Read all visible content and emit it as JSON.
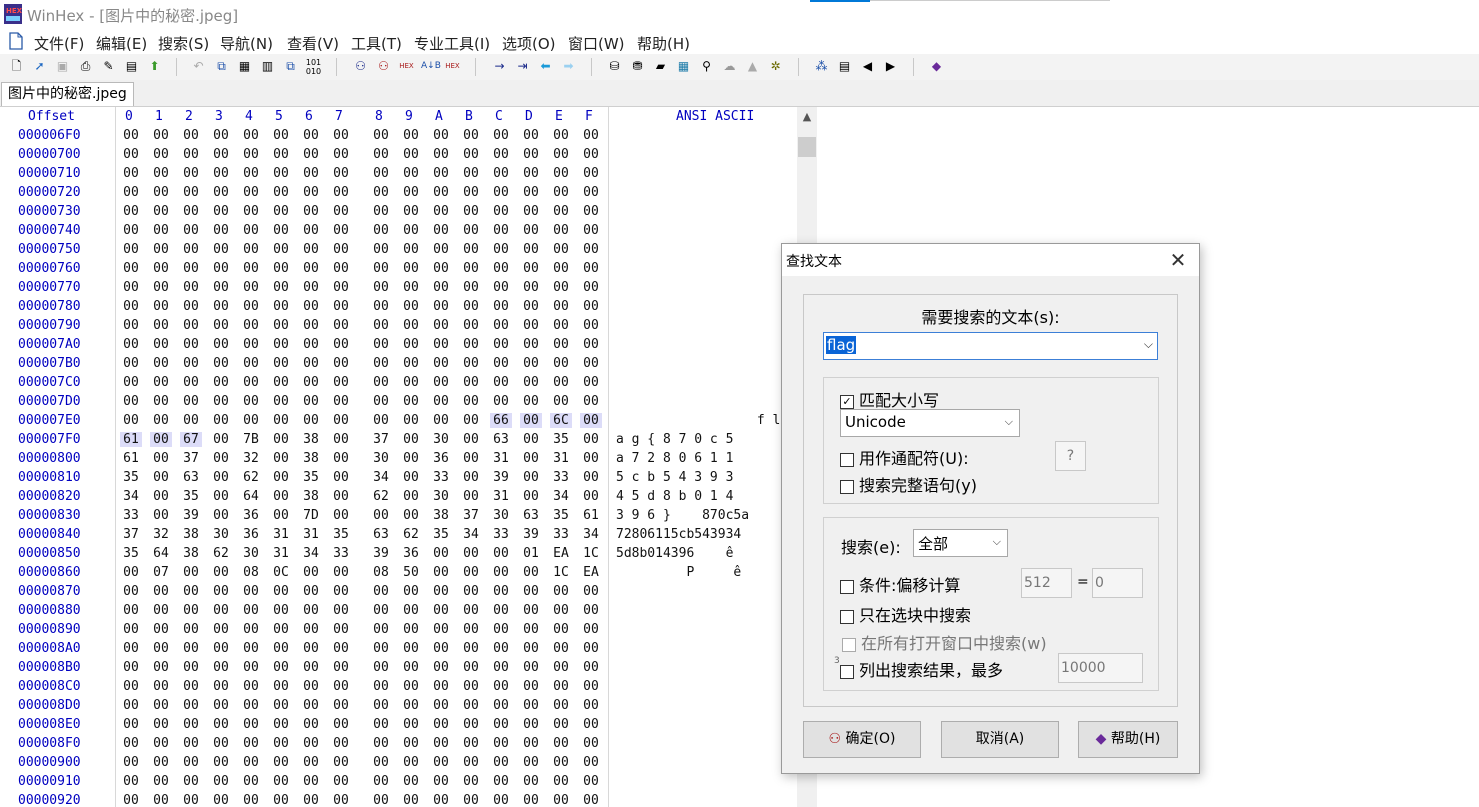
{
  "window": {
    "title": "WinHex - [图片中的秘密.jpeg]"
  },
  "menu": {
    "items": [
      "文件(F)",
      "编辑(E)",
      "搜索(S)",
      "导航(N)",
      "查看(V)",
      "工具(T)",
      "专业工具(I)",
      "选项(O)",
      "窗口(W)",
      "帮助(H)"
    ]
  },
  "toolbar": {
    "buttons": [
      "new-file-icon",
      "open-icon",
      "save-icon",
      "print-icon",
      "properties-icon",
      "export-icon",
      "open-folder-icon",
      "undo-icon",
      "copy-icon",
      "cut-icon",
      "paste-icon",
      "paste-special-icon",
      "binary-icon",
      "find-icon",
      "find-next-icon",
      "find-hex-icon",
      "replace-icon",
      "replace-hex-icon",
      "goto-icon",
      "goto-offset-icon",
      "back-icon",
      "forward-icon",
      "disk-icon",
      "disk2-icon",
      "ram-icon",
      "calc-icon",
      "zoom-icon",
      "hash-icon",
      "template-icon",
      "settings-icon",
      "compare-icon",
      "table-icon",
      "prev-icon",
      "next-icon",
      "help-book-icon"
    ]
  },
  "tab": {
    "label": "图片中的秘密.jpeg"
  },
  "hex": {
    "offset_header": "Offset",
    "col_headers": [
      "0",
      "1",
      "2",
      "3",
      "4",
      "5",
      "6",
      "7",
      "8",
      "9",
      "A",
      "B",
      "C",
      "D",
      "E",
      "F"
    ],
    "ascii_header": "ANSI ASCII",
    "rows": [
      {
        "o": "000006F0",
        "b": [
          "00",
          "00",
          "00",
          "00",
          "00",
          "00",
          "00",
          "00",
          "00",
          "00",
          "00",
          "00",
          "00",
          "00",
          "00",
          "00"
        ],
        "a": ""
      },
      {
        "o": "00000700",
        "b": [
          "00",
          "00",
          "00",
          "00",
          "00",
          "00",
          "00",
          "00",
          "00",
          "00",
          "00",
          "00",
          "00",
          "00",
          "00",
          "00"
        ],
        "a": ""
      },
      {
        "o": "00000710",
        "b": [
          "00",
          "00",
          "00",
          "00",
          "00",
          "00",
          "00",
          "00",
          "00",
          "00",
          "00",
          "00",
          "00",
          "00",
          "00",
          "00"
        ],
        "a": ""
      },
      {
        "o": "00000720",
        "b": [
          "00",
          "00",
          "00",
          "00",
          "00",
          "00",
          "00",
          "00",
          "00",
          "00",
          "00",
          "00",
          "00",
          "00",
          "00",
          "00"
        ],
        "a": ""
      },
      {
        "o": "00000730",
        "b": [
          "00",
          "00",
          "00",
          "00",
          "00",
          "00",
          "00",
          "00",
          "00",
          "00",
          "00",
          "00",
          "00",
          "00",
          "00",
          "00"
        ],
        "a": ""
      },
      {
        "o": "00000740",
        "b": [
          "00",
          "00",
          "00",
          "00",
          "00",
          "00",
          "00",
          "00",
          "00",
          "00",
          "00",
          "00",
          "00",
          "00",
          "00",
          "00"
        ],
        "a": ""
      },
      {
        "o": "00000750",
        "b": [
          "00",
          "00",
          "00",
          "00",
          "00",
          "00",
          "00",
          "00",
          "00",
          "00",
          "00",
          "00",
          "00",
          "00",
          "00",
          "00"
        ],
        "a": ""
      },
      {
        "o": "00000760",
        "b": [
          "00",
          "00",
          "00",
          "00",
          "00",
          "00",
          "00",
          "00",
          "00",
          "00",
          "00",
          "00",
          "00",
          "00",
          "00",
          "00"
        ],
        "a": ""
      },
      {
        "o": "00000770",
        "b": [
          "00",
          "00",
          "00",
          "00",
          "00",
          "00",
          "00",
          "00",
          "00",
          "00",
          "00",
          "00",
          "00",
          "00",
          "00",
          "00"
        ],
        "a": ""
      },
      {
        "o": "00000780",
        "b": [
          "00",
          "00",
          "00",
          "00",
          "00",
          "00",
          "00",
          "00",
          "00",
          "00",
          "00",
          "00",
          "00",
          "00",
          "00",
          "00"
        ],
        "a": ""
      },
      {
        "o": "00000790",
        "b": [
          "00",
          "00",
          "00",
          "00",
          "00",
          "00",
          "00",
          "00",
          "00",
          "00",
          "00",
          "00",
          "00",
          "00",
          "00",
          "00"
        ],
        "a": ""
      },
      {
        "o": "000007A0",
        "b": [
          "00",
          "00",
          "00",
          "00",
          "00",
          "00",
          "00",
          "00",
          "00",
          "00",
          "00",
          "00",
          "00",
          "00",
          "00",
          "00"
        ],
        "a": ""
      },
      {
        "o": "000007B0",
        "b": [
          "00",
          "00",
          "00",
          "00",
          "00",
          "00",
          "00",
          "00",
          "00",
          "00",
          "00",
          "00",
          "00",
          "00",
          "00",
          "00"
        ],
        "a": ""
      },
      {
        "o": "000007C0",
        "b": [
          "00",
          "00",
          "00",
          "00",
          "00",
          "00",
          "00",
          "00",
          "00",
          "00",
          "00",
          "00",
          "00",
          "00",
          "00",
          "00"
        ],
        "a": ""
      },
      {
        "o": "000007D0",
        "b": [
          "00",
          "00",
          "00",
          "00",
          "00",
          "00",
          "00",
          "00",
          "00",
          "00",
          "00",
          "00",
          "00",
          "00",
          "00",
          "00"
        ],
        "a": ""
      },
      {
        "o": "000007E0",
        "b": [
          "00",
          "00",
          "00",
          "00",
          "00",
          "00",
          "00",
          "00",
          "00",
          "00",
          "00",
          "00",
          "66",
          "00",
          "6C",
          "00"
        ],
        "a": "                  f l",
        "sel": [
          12,
          13,
          14,
          15
        ],
        "asel": true
      },
      {
        "o": "000007F0",
        "b": [
          "61",
          "00",
          "67",
          "00",
          "7B",
          "00",
          "38",
          "00",
          "37",
          "00",
          "30",
          "00",
          "63",
          "00",
          "35",
          "00"
        ],
        "a": "a g { 8 7 0 c 5",
        "sel": [
          0,
          1,
          2
        ],
        "asel": true
      },
      {
        "o": "00000800",
        "b": [
          "61",
          "00",
          "37",
          "00",
          "32",
          "00",
          "38",
          "00",
          "30",
          "00",
          "36",
          "00",
          "31",
          "00",
          "31",
          "00"
        ],
        "a": "a 7 2 8 0 6 1 1"
      },
      {
        "o": "00000810",
        "b": [
          "35",
          "00",
          "63",
          "00",
          "62",
          "00",
          "35",
          "00",
          "34",
          "00",
          "33",
          "00",
          "39",
          "00",
          "33",
          "00"
        ],
        "a": "5 c b 5 4 3 9 3"
      },
      {
        "o": "00000820",
        "b": [
          "34",
          "00",
          "35",
          "00",
          "64",
          "00",
          "38",
          "00",
          "62",
          "00",
          "30",
          "00",
          "31",
          "00",
          "34",
          "00"
        ],
        "a": "4 5 d 8 b 0 1 4"
      },
      {
        "o": "00000830",
        "b": [
          "33",
          "00",
          "39",
          "00",
          "36",
          "00",
          "7D",
          "00",
          "00",
          "00",
          "38",
          "37",
          "30",
          "63",
          "35",
          "61"
        ],
        "a": "3 9 6 }    870c5a"
      },
      {
        "o": "00000840",
        "b": [
          "37",
          "32",
          "38",
          "30",
          "36",
          "31",
          "31",
          "35",
          "63",
          "62",
          "35",
          "34",
          "33",
          "39",
          "33",
          "34"
        ],
        "a": "72806115cb543934"
      },
      {
        "o": "00000850",
        "b": [
          "35",
          "64",
          "38",
          "62",
          "30",
          "31",
          "34",
          "33",
          "39",
          "36",
          "00",
          "00",
          "00",
          "01",
          "EA",
          "1C"
        ],
        "a": "5d8b014396    ê"
      },
      {
        "o": "00000860",
        "b": [
          "00",
          "07",
          "00",
          "00",
          "08",
          "0C",
          "00",
          "00",
          "08",
          "50",
          "00",
          "00",
          "00",
          "00",
          "1C",
          "EA"
        ],
        "a": "         P     ê"
      },
      {
        "o": "00000870",
        "b": [
          "00",
          "00",
          "00",
          "00",
          "00",
          "00",
          "00",
          "00",
          "00",
          "00",
          "00",
          "00",
          "00",
          "00",
          "00",
          "00"
        ],
        "a": ""
      },
      {
        "o": "00000880",
        "b": [
          "00",
          "00",
          "00",
          "00",
          "00",
          "00",
          "00",
          "00",
          "00",
          "00",
          "00",
          "00",
          "00",
          "00",
          "00",
          "00"
        ],
        "a": ""
      },
      {
        "o": "00000890",
        "b": [
          "00",
          "00",
          "00",
          "00",
          "00",
          "00",
          "00",
          "00",
          "00",
          "00",
          "00",
          "00",
          "00",
          "00",
          "00",
          "00"
        ],
        "a": ""
      },
      {
        "o": "000008A0",
        "b": [
          "00",
          "00",
          "00",
          "00",
          "00",
          "00",
          "00",
          "00",
          "00",
          "00",
          "00",
          "00",
          "00",
          "00",
          "00",
          "00"
        ],
        "a": ""
      },
      {
        "o": "000008B0",
        "b": [
          "00",
          "00",
          "00",
          "00",
          "00",
          "00",
          "00",
          "00",
          "00",
          "00",
          "00",
          "00",
          "00",
          "00",
          "00",
          "00"
        ],
        "a": ""
      },
      {
        "o": "000008C0",
        "b": [
          "00",
          "00",
          "00",
          "00",
          "00",
          "00",
          "00",
          "00",
          "00",
          "00",
          "00",
          "00",
          "00",
          "00",
          "00",
          "00"
        ],
        "a": ""
      },
      {
        "o": "000008D0",
        "b": [
          "00",
          "00",
          "00",
          "00",
          "00",
          "00",
          "00",
          "00",
          "00",
          "00",
          "00",
          "00",
          "00",
          "00",
          "00",
          "00"
        ],
        "a": ""
      },
      {
        "o": "000008E0",
        "b": [
          "00",
          "00",
          "00",
          "00",
          "00",
          "00",
          "00",
          "00",
          "00",
          "00",
          "00",
          "00",
          "00",
          "00",
          "00",
          "00"
        ],
        "a": ""
      },
      {
        "o": "000008F0",
        "b": [
          "00",
          "00",
          "00",
          "00",
          "00",
          "00",
          "00",
          "00",
          "00",
          "00",
          "00",
          "00",
          "00",
          "00",
          "00",
          "00"
        ],
        "a": ""
      },
      {
        "o": "00000900",
        "b": [
          "00",
          "00",
          "00",
          "00",
          "00",
          "00",
          "00",
          "00",
          "00",
          "00",
          "00",
          "00",
          "00",
          "00",
          "00",
          "00"
        ],
        "a": ""
      },
      {
        "o": "00000910",
        "b": [
          "00",
          "00",
          "00",
          "00",
          "00",
          "00",
          "00",
          "00",
          "00",
          "00",
          "00",
          "00",
          "00",
          "00",
          "00",
          "00"
        ],
        "a": ""
      },
      {
        "o": "00000920",
        "b": [
          "00",
          "00",
          "00",
          "00",
          "00",
          "00",
          "00",
          "00",
          "00",
          "00",
          "00",
          "00",
          "00",
          "00",
          "00",
          "00"
        ],
        "a": ""
      }
    ]
  },
  "dialog": {
    "title": "查找文本",
    "close_glyph": "✕",
    "search_label": "需要搜索的文本(s):",
    "search_value": "flag",
    "match_case": {
      "label": "匹配大小写",
      "checked": true
    },
    "encoding": "Unicode",
    "wildcard": {
      "label": "用作通配符(U):",
      "checked": false,
      "value": "?"
    },
    "whole_words": {
      "label": "搜索完整语句(y)",
      "checked": false
    },
    "direction_label": "搜索(e):",
    "direction_value": "全部",
    "condition": {
      "label": "条件:偏移计算",
      "checked": false,
      "mod": "512",
      "eq": "=",
      "rem": "0"
    },
    "block_only": {
      "label": "只在选块中搜索",
      "checked": false
    },
    "all_windows": {
      "label": "在所有打开窗口中搜索(w)",
      "checked": false,
      "disabled": true
    },
    "list_results": {
      "label": "列出搜索结果，最多",
      "checked": false,
      "max": "10000",
      "prefix": "3"
    },
    "ok_label": "确定(O)",
    "cancel_label": "取消(A)",
    "help_label": "帮助(H)"
  },
  "colors": {
    "offset_blue": "#0000c0",
    "selection": "#dcdcf8",
    "input_highlight": "#0a64d6"
  }
}
